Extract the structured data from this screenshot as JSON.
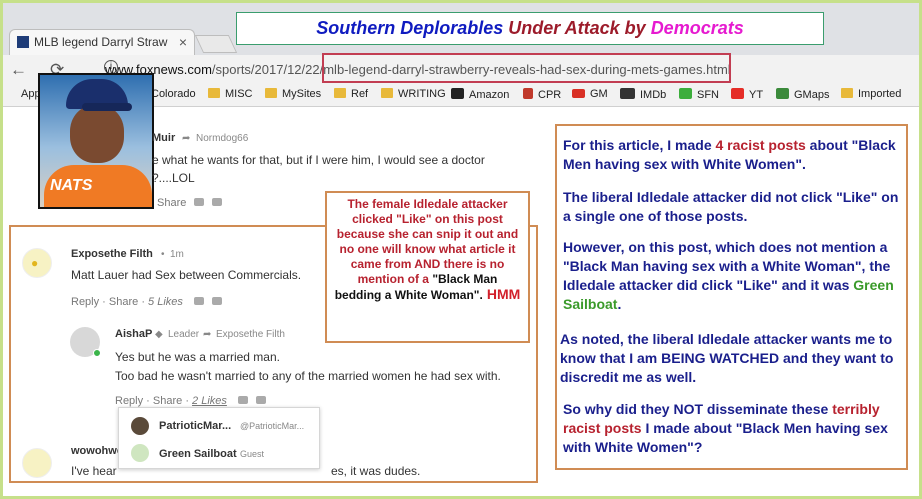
{
  "headline": {
    "part1": "Southern Deplorables",
    "part2": "Under Attack by",
    "part3": "Democrats"
  },
  "browser": {
    "tab_title": "MLB legend Darryl Straw",
    "tab_close": "×",
    "url_host": "www.foxnews.com",
    "url_path": "/sports/2017/12/22/mlb-legend-darryl-strawberry-reveals-had-sex-during-mets-games.html",
    "bookmarks": [
      "Apps",
      "Colorado",
      "MISC",
      "MySites",
      "Ref",
      "WRITING",
      "Amazon",
      "CPR",
      "GM",
      "IMDb",
      "SFN",
      "YT",
      "GMaps",
      "Imported"
    ]
  },
  "photo": {
    "jersey_text": "NATS"
  },
  "comment1": {
    "name": "Muir",
    "reply_to": "Normdog66",
    "line1": "e what he wants for that, but if I were him, I would see a doctor",
    "line2": "?....LOL",
    "share": "Share"
  },
  "comment2": {
    "name": "Exposethe Filth",
    "time": "1m",
    "text": "Matt Lauer had Sex between Commercials.",
    "reply": "Reply",
    "share": "Share",
    "likes": "5 Likes"
  },
  "comment3": {
    "name": "AishaP",
    "role": "Leader",
    "reply_to": "Exposethe Filth",
    "line1": "Yes but he was a married man.",
    "line2": "Too bad he wasn't married to any of the married women he had sex with.",
    "reply": "Reply",
    "share": "Share",
    "likes": "2 Likes"
  },
  "likes_popup": {
    "user1_name": "PatrioticMar...",
    "user1_handle": "@PatrioticMar...",
    "user2_name": "Green Sailboat",
    "user2_handle": "Guest"
  },
  "comment4": {
    "name": "wowohwo",
    "text_start": "I've hear",
    "text_end": "es, it was dudes."
  },
  "female_box": {
    "red_text": "The female Idledale attacker clicked \"Like\" on this post because she can snip it out and no one will know what article it came from AND there is no mention of a",
    "black_text": "\"Black Man bedding a White Woman\".",
    "hmm": "HMM"
  },
  "right_box": {
    "p1_a": "For this article, I made",
    "p1_b": "4 racist posts",
    "p1_c": "about \"Black Men having sex with White Women\".",
    "p2_a": "The liberal Idledale attacker did not click \"Like\" on a single one",
    "p2_b": "of those posts.",
    "p3_a": "However, on this post, which does not mention a \"Black Man having sex with a White Woman\",",
    "p3_b": "the Idledale attacker did click \"Like\" and it was",
    "p3_c": "Green Sailboat",
    "p4": "As noted, the liberal Idledale attacker wants me to know that I am BEING WATCHED and they want to discredit me as well.",
    "p5_a": "So why did they NOT disseminate these",
    "p5_b": "terribly racist posts",
    "p5_c": "I made about \"Black Men having sex with White Women\"?"
  },
  "colors": {
    "accent_red": "#b7222f",
    "accent_green": "#3a9a2a",
    "text_blue": "#1a1f8c",
    "box_border": "#d08c54",
    "frame": "#c6e08a"
  }
}
